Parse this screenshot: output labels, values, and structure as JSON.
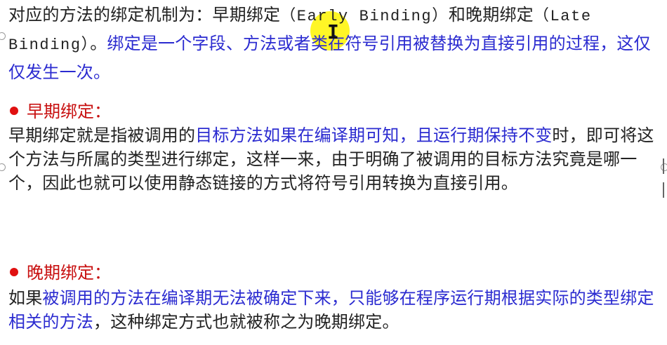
{
  "intro": {
    "line1_prefix": "对应的方法的绑定机制为：早期绑定",
    "early_en": "（Early Binding）",
    "line1_mid": "和晚期绑定",
    "late_en": "（Late Binding）",
    "sentence_end": "。",
    "blue_text": "绑定是一个字段、方法或者类在符号引用被替换为直接引用的过程，这仅仅发生一次。"
  },
  "early": {
    "heading": "早期绑定：",
    "text_start": "早期绑定就是指被调用的",
    "blue_text": "目标方法如果在编译期可知，且运行期保持不变",
    "text_end": "时，即可将这个方法与所属的类型进行绑定，这样一来，由于明确了被调用的目标方法究竟是哪一个，因此也就可以使用静态链接的方式将符号引用转换为直接引用。"
  },
  "late": {
    "heading": "晚期绑定：",
    "text_start": "如果",
    "blue_text": "被调用的方法在编译期无法被确定下来，只能够在程序运行期根据实际的类型绑定相关的方法",
    "text_end": "，这种绑定方式也就被称之为晚期绑定。"
  },
  "colors": {
    "highlight_blue": "#2b2bd0",
    "heading_red": "#c81010",
    "bullet_red": "#e01010",
    "cursor_highlight": "#fff500"
  },
  "icons": {
    "bullet": "red-dot-bullet",
    "cursor": "text-cursor-icon"
  }
}
